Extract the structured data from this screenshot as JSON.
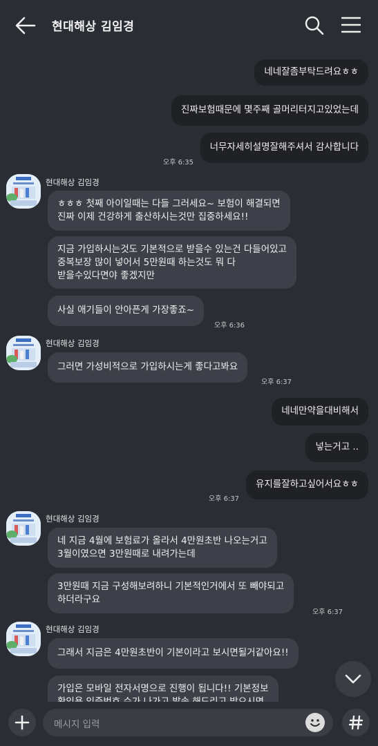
{
  "header": {
    "title": "현대해상 김임경"
  },
  "messages": {
    "m1": "네네잘좀부탁드려요ㅎㅎ",
    "m2": "진짜보험때문에 몇주째 골머리터지고있었는데",
    "m3": "너무자세히설명잘해주셔서 감사합니다",
    "t1": "오후 6:35",
    "sender": "현대해상 김임경",
    "m4": "ㅎㅎㅎ 첫째 아이일때는 다들 그러세요~ 보험이 해결되면\n진짜 이제 건강하게 출산하시는것만 집중하세요!!",
    "m5": "지금 가입하시는것도 기본적으로 받을수 있는건 다들어있고\n중복보장 많이 넣어서 5만원때 하는것도 뭐 다\n받을수있다면야 좋겠지만",
    "m6": "사실 애기들이 안아픈게 가장좋죠~",
    "t2": "오후 6:36",
    "m7": "그러면 가성비적으로 가입하시는게 좋다고봐요",
    "t3": "오후 6:37",
    "m8": "네네만약을대비해서",
    "m9": "넣는거고 ..",
    "m10": "유지를잘하고싶어서요ㅎㅎ",
    "t4": "오후 6:37",
    "m11": "네 지금 4월에 보험료가 올라서 4만원초반 나오는거고\n3월이였으면 3만원때로 내려가는데",
    "m12": "3만원때 지금 구성해보려하니 기본적인거에서 또 빼야되고\n하더라구요",
    "t5": "오후 6:37",
    "m13": "그래서 지금은 4만원초반이 기본이라고 보시면될거같아요!!",
    "m14": "가입은 모바일 전자서명으로 진행이 됩니다!! 기본정보\n확인용 인증번호 수가 나가고 발송 해드리고 받으시면"
  },
  "input": {
    "placeholder": "메시지 입력"
  },
  "icons": {
    "back": "arrow-left-icon",
    "search": "search-icon",
    "menu": "hamburger-menu-icon",
    "scroll": "chevron-down-icon",
    "plus": "plus-icon",
    "emoji": "emoji-icon",
    "hash": "hash-icon"
  }
}
